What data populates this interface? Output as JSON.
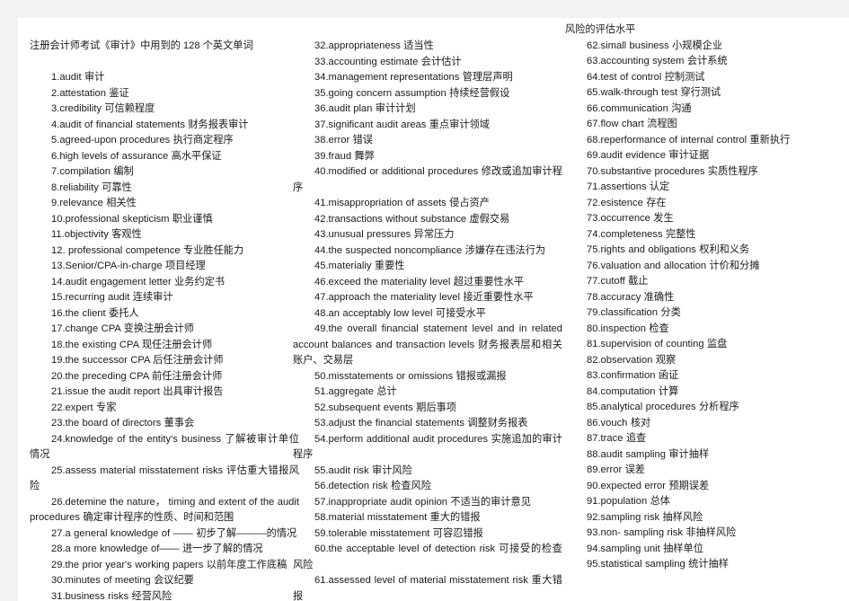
{
  "document": {
    "title": "注册会计师考试《审计》中用到的 128 个英文单词",
    "section_heading_col3": "风险的评估水平"
  },
  "columns": [
    {
      "id": "column-1",
      "entries": [
        "1.audit    审计",
        "2.attestation    鉴证",
        "3.credibility    可信赖程度",
        "4.audit of financial statements 财务报表审计",
        "5.agreed-upon procedures 执行商定程序",
        "6.high levels of assurance 高水平保证",
        "7.compilation  编制",
        "8.reliability 可靠性",
        "9.relevance 相关性",
        "10.professional skepticism  职业谨慎",
        "11.objectivity 客观性",
        "12. professional competence 专业胜任能力",
        "13.Senior/CPA-in-charge 项目经理",
        "14.audit engagement letter 业务约定书",
        "15.recurring audit 连续审计",
        "16.the client 委托人",
        "17.change CPA   变换注册会计师",
        "18.the existing CPA 现任注册会计师",
        "19.the successor CPA 后任注册会计师",
        "20.the preceding CPA 前任注册会计师",
        "21.issue the audit report 出具审计报告",
        "22.expert 专家",
        "23.the board of directors 董事会",
        "24.knowledge of the entity's business  了解被审计单位情况",
        "25.assess material misstatement risks 评估重大错报风险",
        "26.detemine the nature， timing and extent of the audit procedures 确定审计程序的性质、时间和范围",
        "27.a general knowledge of —— 初步了解———的情况",
        "28.a more knowledge of—— 进一步了解的情况",
        "29.the prior year's working papers 以前年度工作底稿",
        "30.minutes of meeting 会议纪要",
        "31.business risks 经营风险"
      ]
    },
    {
      "id": "column-2",
      "entries": [
        "32.appropriateness  适当性",
        "33.accounting estimate  会计估计",
        "34.management representations  管理层声明",
        "35.going concern assumption 持续经营假设",
        "36.audit plan 审计计划",
        "37.significant audit areas 重点审计领域",
        "38.error 错误",
        "39.fraud 舞弊",
        "40.modified or additional procedures 修改或追加审计程序",
        "41.misappropriation of assets 侵占资产",
        "42.transactions without substance 虚假交易",
        "43.unusual pressures 异常压力",
        "44.the suspected noncompliance 涉嫌存在违法行为",
        "45.materialiy 重要性",
        "46.exceed the materiality level 超过重要性水平",
        "47.approach the materiality level 接近重要性水平",
        "48.an acceptably low level 可接受水平",
        "49.the overall financial statement level and in related account balances and transaction levels 财务报表层和相关账户、交易层",
        "50.misstatements or omissions 错报或漏报",
        "51.aggregate 总计",
        "52.subsequent events 期后事项",
        "53.adjust the financial statements 调整财务报表",
        "54.perform additional audit procedures 实施追加的审计程序",
        "55.audit risk 审计风险",
        "56.detection risk 检查风险",
        "57.inappropriate audit opinion 不适当的审计意见",
        "58.material misstatement 重大的错报",
        "59.tolerable misstatement 可容忍错报",
        "60.the acceptable level of detection risk 可接受的检查风险",
        "61.assessed level of material misstatement risk 重大错报"
      ]
    },
    {
      "id": "column-3",
      "entries": [
        "62.simall business 小规模企业",
        "63.accounting system 会计系统",
        "64.test of control 控制测试",
        "65.walk-through test 穿行测试",
        "66.communication 沟通",
        "67.flow chart 流程图",
        "68.reperformance of internal control 重新执行",
        "69.audit evidence 审计证据",
        "70.substantive procedures 实质性程序",
        "71.assertions 认定",
        "72.esistence 存在",
        "73.occurrence 发生",
        "74.completeness 完整性",
        "75.rights and obligations 权利和义务",
        "76.valuation and allocation 计价和分摊",
        "77.cutoff 截止",
        "78.accuracy 准确性",
        "79.classification 分类",
        "80.inspection 检查",
        "81.supervision of counting 监盘",
        "82.observation 观察",
        "83.confirmation 函证",
        "84.computation 计算",
        "85.analytical procedures 分析程序",
        "86.vouch 核对",
        "87.trace 追查",
        "88.audit sampling 审计抽样",
        "89.error 误差",
        "90.expected error 预期误差",
        "91.population 总体",
        "92.sampling risk 抽样风险",
        "93.non- sampling risk 非抽样风险",
        "94.sampling unit 抽样单位",
        "95.statistical sampling 统计抽样"
      ]
    }
  ]
}
